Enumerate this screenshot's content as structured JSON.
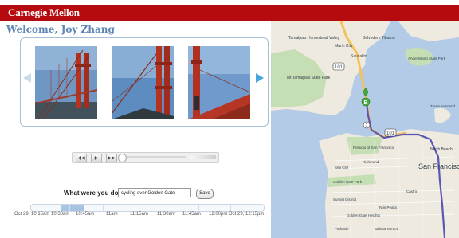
{
  "header": {
    "brand": "Carnegie Mellon"
  },
  "welcome": "Welcome, Joy Zhang",
  "gallery": {
    "photos": [
      {
        "name": "golden-gate-photo-1"
      },
      {
        "name": "golden-gate-photo-2"
      },
      {
        "name": "golden-gate-photo-3"
      }
    ]
  },
  "player": {
    "buttons": [
      "prev",
      "play",
      "next"
    ]
  },
  "activity": {
    "label": "What were you doing:",
    "value": "cycling over Golden Gate",
    "save_label": "Save"
  },
  "timeline": {
    "labels": [
      "Oct 29, 10:15am 10:30am",
      "10:45am",
      "11am",
      "11:15am",
      "11:30am",
      "11:45am",
      "12:00pm Oct 29, 12:15pm"
    ],
    "highlight_fraction": [
      0.13,
      0.23
    ]
  },
  "map": {
    "labels": {
      "tamalpais_valley": "Tamalpais Homestead Valley",
      "marin_city": "Marin City",
      "belvedere": "Belvedere Tiburon",
      "sausalito": "Sausalito",
      "mt_tam": "Mt Tamalpais State Park",
      "angel_island": "Angel Island State Park",
      "presidio": "Presidio of San Francisco",
      "north_beach": "North Beach",
      "treasure": "Treasure Island",
      "sf": "San Francisco",
      "golden_gate_park": "Golden Gate Park",
      "sunset": "Sunset District",
      "sea_cliff": "Sea Cliff",
      "castro": "Castro",
      "twin_peaks": "Twin Peaks",
      "parkside": "Parkside",
      "golden_gate_heights": "Golden Gate Heights",
      "balboa": "Balboa Terrace",
      "sunset_dist": "Sunset",
      "richmond": "Richmond",
      "marker": "B",
      "hwy101_a": "101",
      "hwy101_b": "101",
      "hwy1": "1"
    },
    "colors": {
      "water": "#b3cbe6",
      "land": "#eeeadf",
      "park": "#c6deb3",
      "route": "#5b56b4",
      "highway": "#f4c25a"
    }
  }
}
